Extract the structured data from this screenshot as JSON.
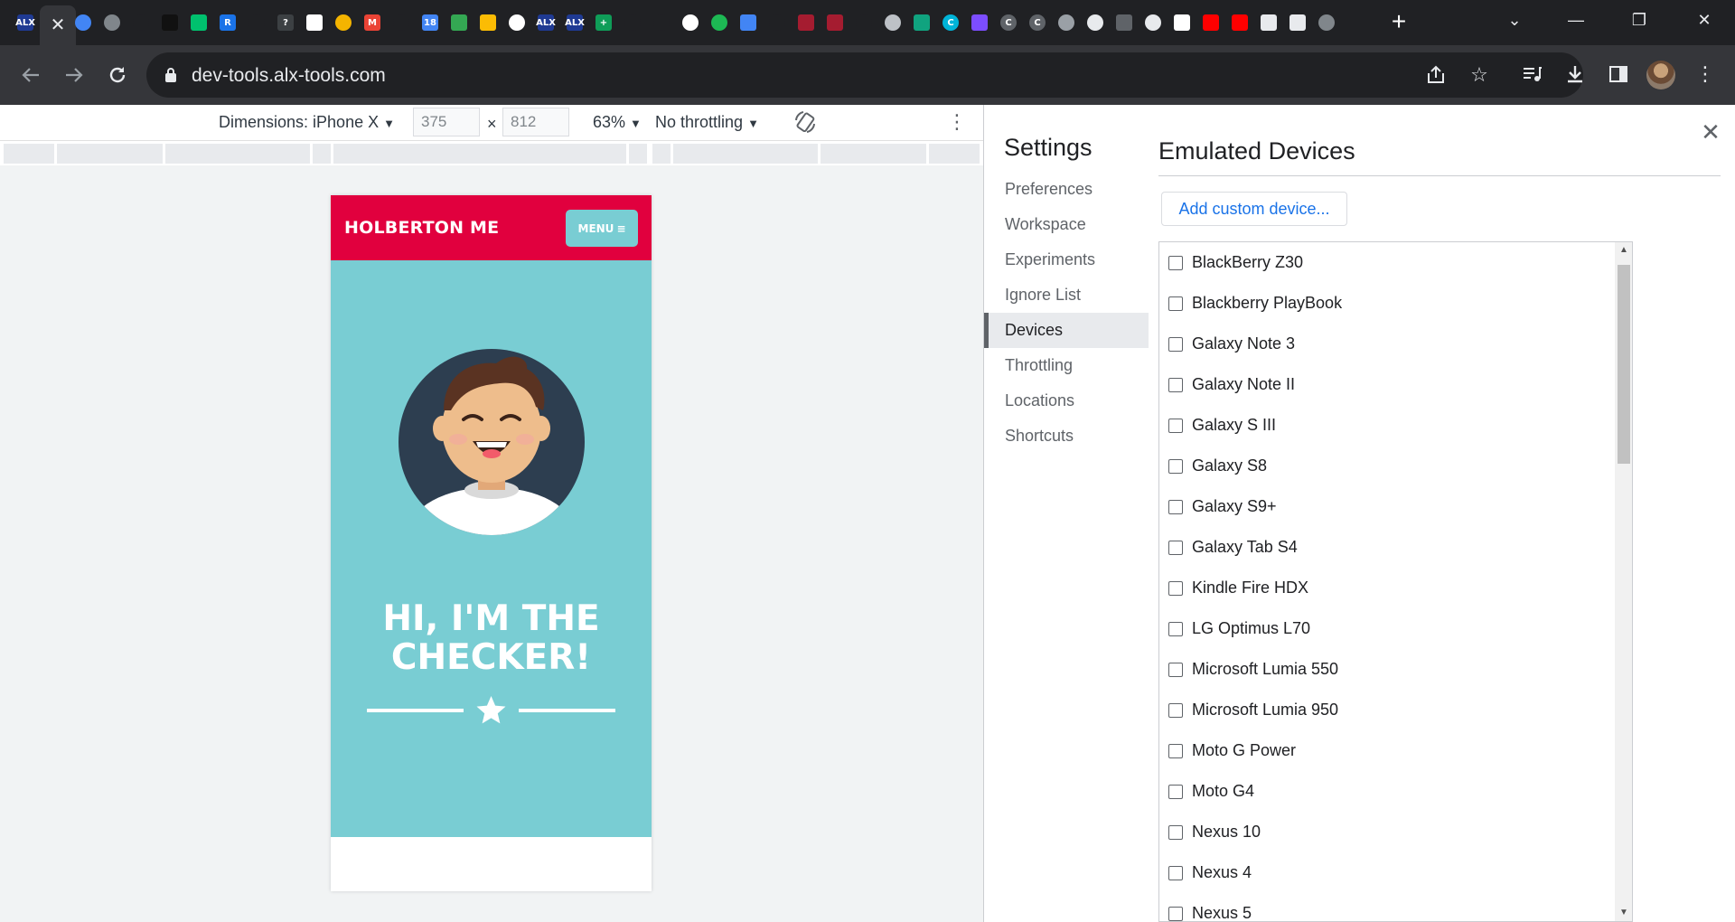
{
  "browser": {
    "url": "dev-tools.alx-tools.com",
    "tabs": [
      {
        "icon": "alx-icon",
        "text": "ALX",
        "color": "#1f3a93"
      },
      {
        "icon": "close-icon",
        "active": true
      },
      {
        "icon": "chrome-icon",
        "color": "#4285f4"
      },
      {
        "icon": "globe-icon",
        "color": "#80868b"
      },
      {
        "icon": "github-icon",
        "color": "#202124"
      },
      {
        "icon": "app-icon",
        "color": "#111111"
      },
      {
        "icon": "play-icon",
        "color": "#00c16e"
      },
      {
        "icon": "r-icon",
        "text": "R",
        "color": "#1a73e8"
      },
      {
        "icon": "github-icon",
        "color": "#202124"
      },
      {
        "icon": "help-icon",
        "text": "?",
        "color": "#3c4043"
      },
      {
        "icon": "calendar-icon",
        "color": "#ffffff"
      },
      {
        "icon": "coin-icon",
        "color": "#f4b400"
      },
      {
        "icon": "gmail-icon",
        "text": "M",
        "color": "#ea4335"
      },
      {
        "icon": "github-icon",
        "color": "#202124"
      },
      {
        "icon": "calendar-icon",
        "text": "18",
        "color": "#4285f4"
      },
      {
        "icon": "drive-icon",
        "color": "#34a853"
      },
      {
        "icon": "drive-icon",
        "color": "#fbbc04"
      },
      {
        "icon": "google-icon",
        "color": "#ffffff"
      },
      {
        "icon": "alx-icon",
        "text": "ALX",
        "color": "#1f3a93"
      },
      {
        "icon": "alx-icon",
        "text": "ALX",
        "color": "#1f3a93"
      },
      {
        "icon": "plus-icon",
        "text": "+",
        "color": "#0f9d58"
      },
      {
        "icon": "github-icon",
        "color": "#202124"
      },
      {
        "icon": "github-icon",
        "color": "#202124"
      },
      {
        "icon": "google-icon",
        "color": "#ffffff"
      },
      {
        "icon": "spotify-icon",
        "color": "#1db954"
      },
      {
        "icon": "docs-icon",
        "color": "#4285f4"
      },
      {
        "icon": "github-icon",
        "color": "#202124"
      },
      {
        "icon": "harvard-icon",
        "color": "#a51c30"
      },
      {
        "icon": "harvard-icon",
        "color": "#a51c30"
      },
      {
        "icon": "github-icon",
        "color": "#202124"
      },
      {
        "icon": "circle-icon",
        "color": "#bdc1c6"
      },
      {
        "icon": "openai-icon",
        "color": "#10a37f"
      },
      {
        "icon": "c-icon",
        "text": "C",
        "color": "#00b4d8"
      },
      {
        "icon": "app-icon",
        "color": "#7c4dff"
      },
      {
        "icon": "c-icon",
        "text": "C",
        "color": "#5f6368"
      },
      {
        "icon": "c-icon",
        "text": "C",
        "color": "#5f6368"
      },
      {
        "icon": "gear-icon",
        "color": "#9aa0a6"
      },
      {
        "icon": "circle-icon",
        "color": "#e8eaed"
      },
      {
        "icon": "app-icon",
        "color": "#5f6368"
      },
      {
        "icon": "circle-icon",
        "color": "#e8eaed"
      },
      {
        "icon": "app-icon",
        "color": "#ffffff"
      },
      {
        "icon": "youtube-icon",
        "color": "#ff0000"
      },
      {
        "icon": "youtube-icon",
        "color": "#ff0000"
      },
      {
        "icon": "blank-icon",
        "color": "#e8eaed"
      },
      {
        "icon": "blank-icon",
        "color": "#e8eaed"
      },
      {
        "icon": "globe-icon",
        "color": "#80868b"
      }
    ]
  },
  "device_toolbar": {
    "dimensions_label": "Dimensions: iPhone X",
    "width": "375",
    "height": "812",
    "times": "×",
    "zoom": "63%",
    "throttling": "No throttling"
  },
  "site": {
    "logo": "HOLBERTON ME",
    "menu_label": "MENU",
    "hero_title_line1": "HI, I'M THE",
    "hero_title_line2": "CHECKER!",
    "colors": {
      "header": "#e1003e",
      "hero": "#79cdd3",
      "menu": "#79cdd3"
    }
  },
  "settings": {
    "title": "Settings",
    "nav": [
      "Preferences",
      "Workspace",
      "Experiments",
      "Ignore List",
      "Devices",
      "Throttling",
      "Locations",
      "Shortcuts"
    ],
    "selected": "Devices",
    "panel_title": "Emulated Devices",
    "add_button": "Add custom device...",
    "devices": [
      "BlackBerry Z30",
      "Blackberry PlayBook",
      "Galaxy Note 3",
      "Galaxy Note II",
      "Galaxy S III",
      "Galaxy S8",
      "Galaxy S9+",
      "Galaxy Tab S4",
      "Kindle Fire HDX",
      "LG Optimus L70",
      "Microsoft Lumia 550",
      "Microsoft Lumia 950",
      "Moto G Power",
      "Moto G4",
      "Nexus 10",
      "Nexus 4",
      "Nexus 5"
    ]
  }
}
